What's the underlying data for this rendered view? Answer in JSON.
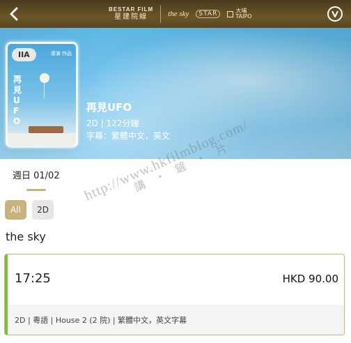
{
  "header": {
    "back_icon": "chevron-left-icon",
    "logo_bestar_en": "BESTAR FILM",
    "logo_bestar_zh": "星建院線",
    "logo_sky": "the sky",
    "logo_star": "STAR",
    "logo_taipo_zh": "大埔",
    "logo_taipo_en": "TAIPO",
    "account_icon": "v-circle-icon"
  },
  "movie": {
    "rating": "IIA",
    "title": "再見UFO",
    "poster_title": "再見UFO",
    "poster_top_text": "導演 作品",
    "format_runtime": "2D | 122分鐘",
    "subtitles": "字幕：繁體中文，英文"
  },
  "date_tab": {
    "label": "週日 01/02"
  },
  "filters": [
    {
      "label": "All",
      "selected": true
    },
    {
      "label": "2D",
      "selected": false
    }
  ],
  "cinema": {
    "name": "the sky"
  },
  "showtime": {
    "time": "17:25",
    "price": "HKD 90.00",
    "details": "2D | 粵語 | House 2 (2 院) | 繁體中文，英文字幕"
  },
  "watermark": {
    "url": "http://www.hkfilmblog.com/",
    "cn": "講・鏟・片"
  },
  "colors": {
    "accent_gold": "#c8b27e",
    "header_brown": "#5a4622",
    "card_accent_green": "#7bbf3f"
  }
}
